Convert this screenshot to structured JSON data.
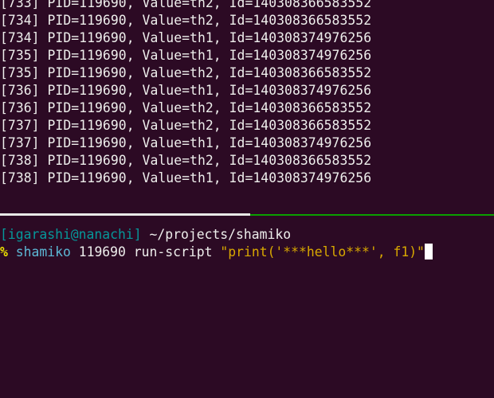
{
  "log": {
    "lines": [
      "[733] PID=119690, Value=th2, Id=140308366583552",
      "[734] PID=119690, Value=th2, Id=140308366583552",
      "[734] PID=119690, Value=th1, Id=140308374976256",
      "[735] PID=119690, Value=th1, Id=140308374976256",
      "[735] PID=119690, Value=th2, Id=140308366583552",
      "[736] PID=119690, Value=th1, Id=140308374976256",
      "[736] PID=119690, Value=th2, Id=140308366583552",
      "[737] PID=119690, Value=th2, Id=140308366583552",
      "[737] PID=119690, Value=th1, Id=140308374976256",
      "[738] PID=119690, Value=th2, Id=140308366583552",
      "[738] PID=119690, Value=th1, Id=140308374976256"
    ]
  },
  "prompt": {
    "user_host": "[igarashi@nanachi]",
    "cwd": " ~/projects/shamiko",
    "symbol": "%",
    "command": "shamiko",
    "pid_arg": "119690",
    "subcommand": "run-script",
    "script_arg": "\"print('***hello***', f1)\""
  },
  "colors": {
    "background": "#2c0a24",
    "user_host": "#06989a",
    "prompt_symbol": "#ece200",
    "command": "#5cb8d6",
    "string": "#d8a800",
    "active_pane_border": "#0aa000"
  }
}
